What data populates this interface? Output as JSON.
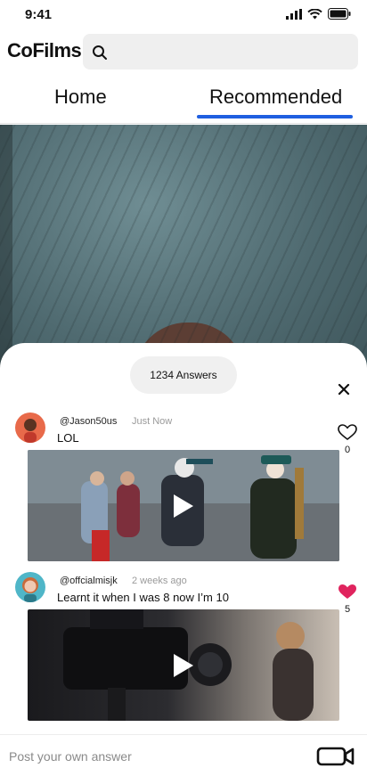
{
  "status": {
    "time": "9:41"
  },
  "header": {
    "logo": "CoFilms",
    "search_placeholder": ""
  },
  "tabs": [
    {
      "label": "Home"
    },
    {
      "label": "Recommended"
    }
  ],
  "sheet": {
    "answers_count": "1234 Answers",
    "answers": [
      {
        "handle": "@Jason50us",
        "time": "Just Now",
        "text": "LOL",
        "likes": "0",
        "liked": false
      },
      {
        "handle": "@offcialmisjk",
        "time": "2 weeks ago",
        "text": "Learnt it when I was 8 now I’m 10",
        "likes": "5",
        "liked": true
      }
    ]
  },
  "compose": {
    "placeholder": "Post your own answer"
  },
  "colors": {
    "accent": "#1f5fe0",
    "liked": "#e0245e"
  }
}
